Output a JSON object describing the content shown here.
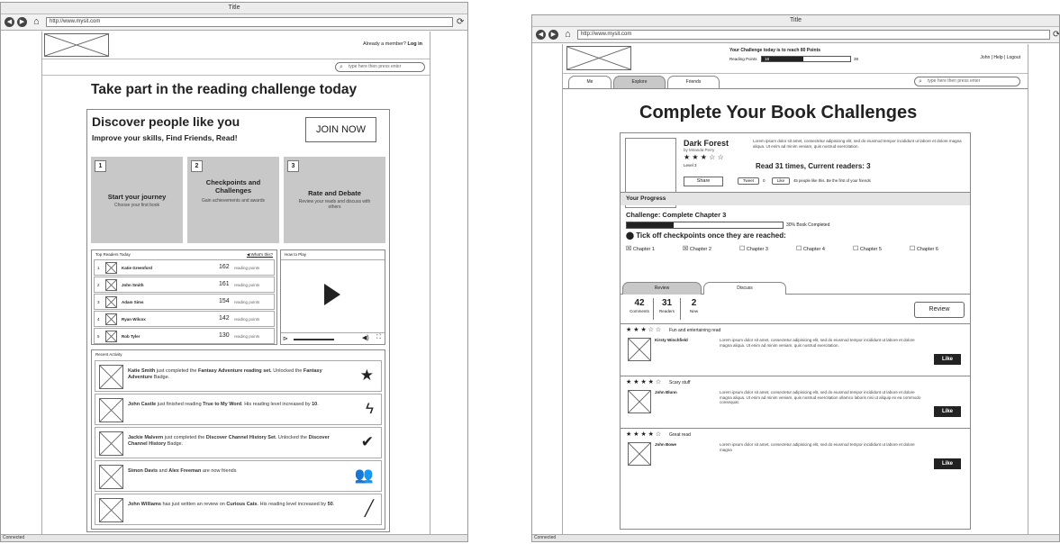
{
  "left": {
    "title": "Title",
    "url": "http://www.mysit.com",
    "status": "Connected",
    "member": "Already a member? ",
    "login": "Log in",
    "search_placeholder": "type here then press enter",
    "headline": "Take part in the reading challenge today",
    "hero_title": "Discover people like you",
    "hero_sub": "Improve your skills, Find Friends, Read!",
    "join": "JOIN NOW",
    "steps": [
      {
        "num": "1",
        "title": "Start your journey",
        "desc": "Choose your first book"
      },
      {
        "num": "2",
        "title": "Checkpoints and Challenges",
        "desc": "Gain achievements and awards"
      },
      {
        "num": "3",
        "title": "Rate and Debate",
        "desc": "Review your reads and discuss with others"
      }
    ],
    "top_readers_title": "Top Readers Today",
    "whats_this": "What's this?",
    "how_to_play": "How to Play",
    "readers": [
      {
        "rank": "1",
        "name": "Katie Greenford",
        "points": "162",
        "unit": "reading points"
      },
      {
        "rank": "2",
        "name": "John Smith",
        "points": "161",
        "unit": "reading points"
      },
      {
        "rank": "3",
        "name": "Adam Sims",
        "points": "154",
        "unit": "reading points"
      },
      {
        "rank": "4",
        "name": "Ryan Wilcox",
        "points": "142",
        "unit": "reading points"
      },
      {
        "rank": "5",
        "name": "Rob Tyler",
        "points": "130",
        "unit": "reading points"
      }
    ],
    "recent_title": "Recent Activity",
    "activities": [
      {
        "a": "Katie Smith",
        "b": " just completed the ",
        "c": "Fantasy Adventure reading set.",
        "d": " Unlocked the ",
        "e": "Fantasy Adventure",
        "f": " Badge.",
        "icon": "star-icon",
        "glyph": "★"
      },
      {
        "a": "John Castle",
        "b": " just finished reading ",
        "c": "True to My Word",
        "d": ". His reading level increased by ",
        "e": "10",
        "f": ".",
        "icon": "lightning-icon",
        "glyph": "ϟ"
      },
      {
        "a": "Jackie Malvern",
        "b": " just completed the ",
        "c": "Discover Channel History Set",
        "d": ". Unlocked the ",
        "e": "Discover Channel History",
        "f": " Badge.",
        "icon": "check-badge-icon",
        "glyph": "✔"
      },
      {
        "a": "Simon Davis",
        "b": " and ",
        "c": "Alex Freeman",
        "d": " are now friends",
        "e": "",
        "f": "",
        "icon": "people-icon",
        "glyph": "👥"
      },
      {
        "a": "John Williams",
        "b": " has just written an review on ",
        "c": "Curious Cats",
        "d": ". His reading level increased by ",
        "e": "50",
        "f": ".",
        "icon": "pencil-icon",
        "glyph": "╱"
      }
    ]
  },
  "right": {
    "title": "Title",
    "url": "http://www.mysit.com",
    "status": "Connected",
    "challenge_text": "Your Challenge today is to reach 80 Points",
    "reading_points_label": "Reading Points",
    "points_current": "18",
    "points_target": "38",
    "user_links": "John | Help | Logout",
    "tabs": [
      "Me",
      "Explore",
      "Friends"
    ],
    "search_placeholder": "type here then press enter",
    "headline": "Complete Your Book Challenges",
    "book": {
      "title": "Dark Forest",
      "author": "by Miranda Perry",
      "stars": "★ ★ ★ ☆ ☆",
      "level": "Level 3",
      "lorem": "Lorem ipsum dolor sit amet, consectetur adipisicing elit, sed do eiusmod tempor incididunt ut labore et dolore magna aliqua. Ut enim ad minim veniam, quis nostrud exercitation.",
      "reads": "Read 31 times, Current readers: 3",
      "share": "Share",
      "tweet": "Tweet",
      "tweet_count": "0",
      "like": "Like",
      "like_text": "45 people like this. Be the first of your friends"
    },
    "progress_title": "Your Progress",
    "challenge_name": "Challenge: Complete Chapter 3",
    "progress_value": 0.3,
    "progress_label": "30% Book Completed",
    "tick_title": "Tick off checkpoints once they are reached:",
    "chapters": [
      {
        "label": "Chapter 1",
        "checked": "☒"
      },
      {
        "label": "Chapter 2",
        "checked": "☒"
      },
      {
        "label": "Chapter 3",
        "checked": "☐"
      },
      {
        "label": "Chapter 4",
        "checked": "☐"
      },
      {
        "label": "Chapter 5",
        "checked": "☐"
      },
      {
        "label": "Chapter 6",
        "checked": "☐"
      }
    ],
    "sub_tabs": [
      "Review",
      "Discuss"
    ],
    "stats": [
      {
        "num": "42",
        "label": "Comments"
      },
      {
        "num": "31",
        "label": "Readers"
      },
      {
        "num": "2",
        "label": "New"
      }
    ],
    "review_button": "Review",
    "reviews": [
      {
        "stars": "★ ★ ★ ☆ ☆",
        "title": "Fun and entertaining read",
        "name": "Kirsty Winchfield",
        "text": "Lorem ipsum dolor sit amet, consectetur adipisicing elit, sed do eiusmod tempor incididunt ut labore et dolore magna aliqua. Ut enim ad minim veniam, quis nostrud exercitation.",
        "like": "Like"
      },
      {
        "stars": "★ ★ ★ ★ ☆",
        "title": "Scary stuff",
        "name": "John Blunn",
        "text": "Lorem ipsum dolor sit amet, consectetur adipisicing elit, sed do eiusmod tempor incididunt ut labore et dolore magna aliqua. Ut enim ad minim veniam, quis nostrud exercitation ullamco laboris nisi ut aliquip ex ea commodo consequat.",
        "like": "Like"
      },
      {
        "stars": "★ ★ ★ ★ ☆",
        "title": "Great read",
        "name": "John Bowe",
        "text": "Lorem ipsum dolor sit amet, consectetur adipisicing elit, sed do eiusmod tempor incididunt ut labore et dolore magna",
        "like": "Like"
      }
    ]
  }
}
